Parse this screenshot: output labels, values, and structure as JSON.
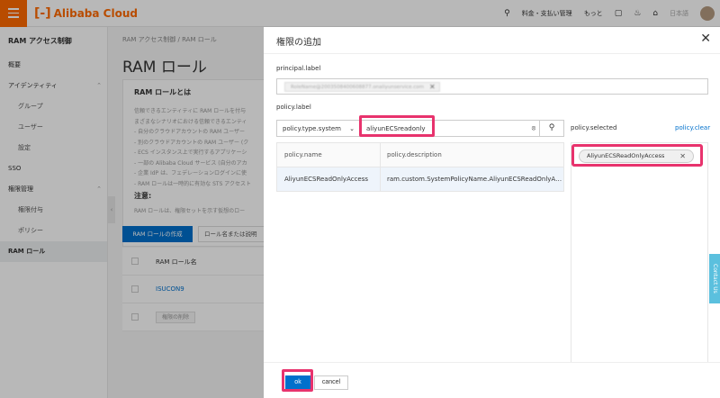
{
  "topbar": {
    "brand": "Alibaba Cloud",
    "brand_mark": "[-]",
    "billing": "料金・支払い管理",
    "more": "もっと",
    "language": "日本語"
  },
  "sidebar": {
    "title": "RAM アクセス制御",
    "items": [
      {
        "label": "概要"
      },
      {
        "label": "アイデンティティ"
      },
      {
        "label": "グループ"
      },
      {
        "label": "ユーザー"
      },
      {
        "label": "設定"
      },
      {
        "label": "SSO"
      },
      {
        "label": "権限管理"
      },
      {
        "label": "権限付与"
      },
      {
        "label": "ポリシー"
      },
      {
        "label": "RAM ロール"
      }
    ]
  },
  "main": {
    "breadcrumb": "RAM アクセス制御 / RAM ロール",
    "title": "RAM ロール",
    "info_title": "RAM ロールとは",
    "info_lines": [
      "信頼できるエンティティに RAM ロールを付与",
      "まざまなシナリオにおける信頼できるエンティ",
      "- 自分のクラウドアカウントの RAM ユーザー",
      "- 別のクラウドアカウントの RAM ユーザー (ク",
      "- ECS インスタンス上で実行するアプリケーシ",
      "- 一部の Alibaba Cloud サービス (自分のアカ",
      "- 企業 IdP は、フェデレーションログインに使",
      "- RAM ロールは一時的に有効な STS アクセスト"
    ],
    "note_title": "注意:",
    "note_text": "RAM ロールは、権限セットを示す仮想のロー",
    "create_button": "RAM ロールの作成",
    "search_placeholder": "ロール名または説明",
    "col_role_name": "RAM ロール名",
    "role_row": "ISUCON9",
    "bulk_delete": "権限の削除"
  },
  "drawer": {
    "title": "権限の追加",
    "principal_label": "principal.label",
    "principal_value": "RoleName@2003508400608877.onaliyunservice.com",
    "policy_label": "policy.label",
    "policy_type": "policy.type.system",
    "search_value": "aliyunECSreadonly",
    "table": {
      "headers": [
        "policy.name",
        "policy.description"
      ],
      "rows": [
        {
          "name": "AliyunECSReadOnlyAccess",
          "description": "ram.custom.SystemPolicyName.AliyunECSReadOnlyAccess"
        }
      ]
    },
    "selected_label": "policy.selected",
    "clear_label": "policy.clear",
    "selected_items": [
      "AliyunECSReadOnlyAccess"
    ],
    "ok": "ok",
    "cancel": "cancel"
  },
  "contact": "Contact Us",
  "colors": {
    "brand": "#ff6a00",
    "primary": "#0070cc",
    "highlight": "#e8336d"
  }
}
